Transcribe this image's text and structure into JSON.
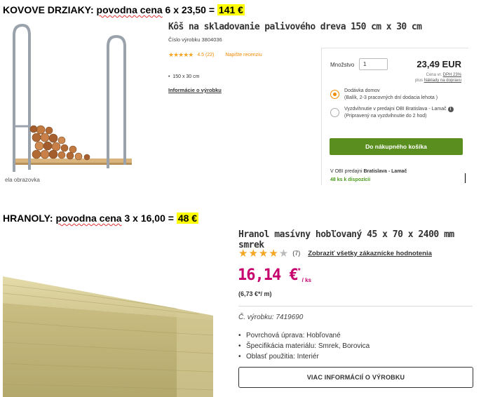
{
  "section1": {
    "heading": {
      "prefix": "KOVOVE DRZIAKY: ",
      "underlined": "povodna cena",
      "calc": " 6 x 23,50 = ",
      "total": "141 €"
    },
    "image_caption": "ela obrazovka",
    "product": {
      "title": "Kôš na skladovanie palivového dreva 150 cm x 30 cm",
      "code": "Číslo výrobku 3804036",
      "rating_stars": "★★★★★",
      "rating_score": "4.5 (22)",
      "write_review": "Napište recenziu",
      "bullet": "150 x 30 cm",
      "info_link": "Informácie o výrobku"
    },
    "buybox": {
      "qty_label": "Množstvo",
      "qty_value": "1",
      "price": "23,49 EUR",
      "vat_line1_prefix": "Cena vr. ",
      "vat_line1_link": "DPH 23%",
      "vat_line2_prefix": "plus ",
      "vat_line2_link": "Náklady na dopravu",
      "delivery_title": "Dodávka domov",
      "delivery_sub": "(Balík, 2-3 pracovných dní dodacia lehota )",
      "pickup_title": "Vyzdvihnutie v predajni OBI Bratislava - Lamač",
      "pickup_sub": "(Pripravený na vyzdvihnutie do 2 hod)",
      "cart_button": "Do nákupného košíka",
      "store_prefix": "V OBI predajni ",
      "store_name": "Bratislava - Lamač",
      "stock": "48 ks k dispozícii"
    }
  },
  "section2": {
    "heading": {
      "prefix": "HRANOLY: ",
      "underlined": "povodna cena",
      "calc": " 3 x 16,00 = ",
      "total": "48 €"
    },
    "product": {
      "title": "Hranol masívny hobľovaný 45 x 70 x 2400 mm smrek",
      "stars_on": "★★★★",
      "stars_off": "★",
      "review_count": "(7)",
      "all_reviews": "Zobraziť všetky zákaznícke hodnotenia",
      "price": "16,14 €",
      "price_sup": "*",
      "price_unit": "/ ks",
      "unit_price": "(6,73 €*/ m)",
      "code": "Č. výrobku: 7419690",
      "specs": [
        "Povrchová úprava: Hobľované",
        "Špecifikácia materiálu: Smrek, Borovica",
        "Oblasť použitia: Interiér"
      ],
      "more_button": "VIAC INFORMÁCIÍ O VÝROBKU"
    }
  },
  "colors": {
    "highlight": "#ffff00",
    "obi_orange": "#f08a00",
    "cart_green": "#5a8f1f",
    "stock_green": "#4a9b1c",
    "price_magenta": "#c6006d"
  }
}
